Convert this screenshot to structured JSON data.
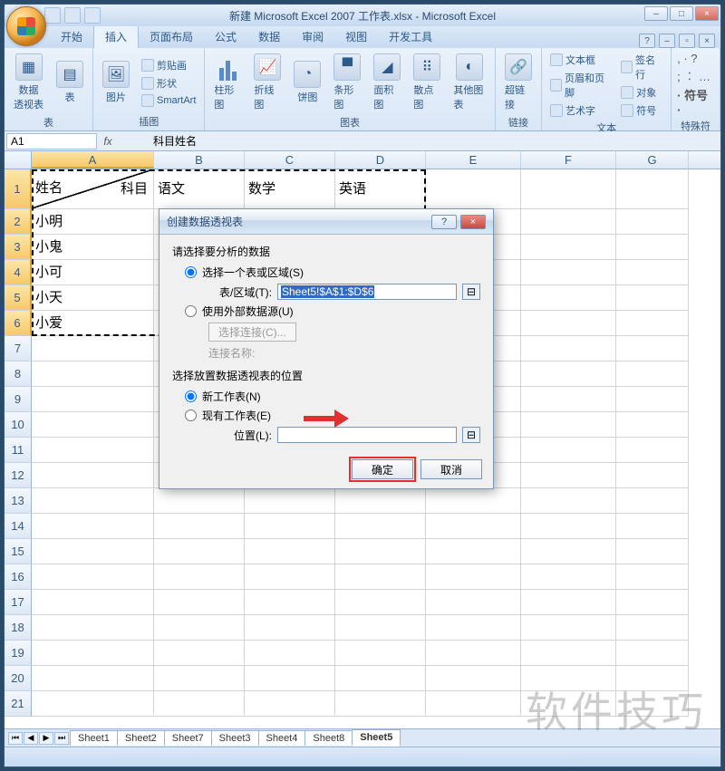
{
  "title": "新建 Microsoft Excel 2007 工作表.xlsx - Microsoft Excel",
  "tabs": {
    "start": "开始",
    "insert": "插入",
    "layout": "页面布局",
    "formula": "公式",
    "data": "数据",
    "review": "审阅",
    "view": "视图",
    "dev": "开发工具"
  },
  "ribbon": {
    "tables": {
      "pivot": "数据\n透视表",
      "table": "表",
      "label": "表"
    },
    "illus": {
      "pic": "图片",
      "clip": "剪贴画",
      "shapes": "形状",
      "smart": "SmartArt",
      "label": "插图"
    },
    "charts": {
      "col": "柱形图",
      "line": "折线图",
      "pie": "饼图",
      "bar": "条形图",
      "area": "面积图",
      "scatter": "散点图",
      "other": "其他图表",
      "label": "图表"
    },
    "links": {
      "hyper": "超链接",
      "label": "链接"
    },
    "text": {
      "textbox": "文本框",
      "hf": "页眉和页脚",
      "wordart": "艺术字",
      "sig": "签名行",
      "obj": "对象",
      "sym": "符号",
      "label": "文本"
    },
    "symbols": {
      "label": "特殊符号"
    }
  },
  "namebox": "A1",
  "formula": "科目姓名",
  "cols": [
    "A",
    "B",
    "C",
    "D",
    "E",
    "F",
    "G"
  ],
  "cells": {
    "r1_subject": "科目",
    "r1_name": "姓名",
    "r1b": "语文",
    "r1c": "数学",
    "r1d": "英语",
    "r2": "小明",
    "r3": "小鬼",
    "r4": "小可",
    "r5": "小天",
    "r6": "小爱"
  },
  "rownums": [
    "1",
    "2",
    "3",
    "4",
    "5",
    "6",
    "7",
    "8",
    "9",
    "10",
    "11",
    "12",
    "13",
    "14",
    "15",
    "16",
    "17",
    "18",
    "19",
    "20",
    "21"
  ],
  "sheets": [
    "Sheet1",
    "Sheet2",
    "Sheet7",
    "Sheet3",
    "Sheet4",
    "Sheet8",
    "Sheet5"
  ],
  "dialog": {
    "title": "创建数据透视表",
    "sect1": "请选择要分析的数据",
    "opt1": "选择一个表或区域(S)",
    "range_lbl": "表/区域(T):",
    "range_val": "Sheet5!$A$1:$D$6",
    "opt2": "使用外部数据源(U)",
    "conn_btn": "选择连接(C)...",
    "conn_lbl": "连接名称:",
    "sect2": "选择放置数据透视表的位置",
    "opt3": "新工作表(N)",
    "opt4": "现有工作表(E)",
    "loc_lbl": "位置(L):",
    "ok": "确定",
    "cancel": "取消"
  },
  "watermark": "软件技巧"
}
